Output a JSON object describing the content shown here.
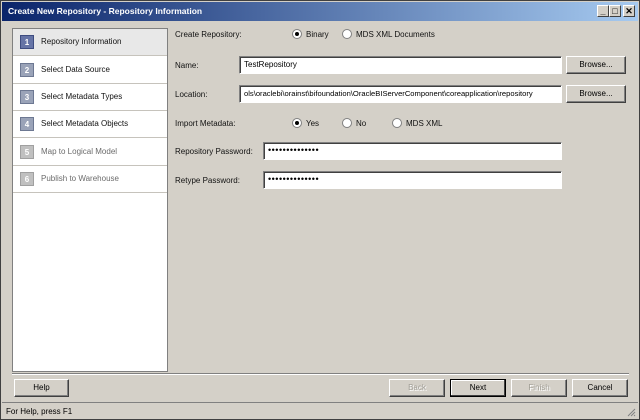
{
  "window": {
    "title": "Create New Repository - Repository Information",
    "minimize_glyph": "_",
    "maximize_glyph": "□",
    "close_glyph": "✕"
  },
  "steps": [
    {
      "num": "1",
      "label": "Repository Information",
      "state": "active"
    },
    {
      "num": "2",
      "label": "Select Data Source",
      "state": "enabled"
    },
    {
      "num": "3",
      "label": "Select Metadata Types",
      "state": "enabled"
    },
    {
      "num": "4",
      "label": "Select Metadata Objects",
      "state": "enabled"
    },
    {
      "num": "5",
      "label": "Map to Logical Model",
      "state": "disabled"
    },
    {
      "num": "6",
      "label": "Publish to Warehouse",
      "state": "disabled"
    }
  ],
  "form": {
    "create_repository_label": "Create Repository:",
    "create_options": [
      "Binary",
      "MDS XML Documents"
    ],
    "create_selected": "Binary",
    "name_label": "Name:",
    "name_value": "TestRepository",
    "location_label": "Location:",
    "location_value": "ols\\oraclebi\\orainst\\bifoundation\\OracleBIServerComponent\\coreapplication\\repository",
    "browse_label": "Browse...",
    "import_label": "Import Metadata:",
    "import_options": [
      "Yes",
      "No",
      "MDS XML"
    ],
    "import_selected": "Yes",
    "password_label": "Repository Password:",
    "password_value": "••••••••••••••",
    "retype_label": "Retype Password:",
    "retype_value": "••••••••••••••"
  },
  "buttons": {
    "help": "Help",
    "back": "Back",
    "next": "Next",
    "finish": "Finish",
    "cancel": "Cancel"
  },
  "status": "For Help, press F1"
}
